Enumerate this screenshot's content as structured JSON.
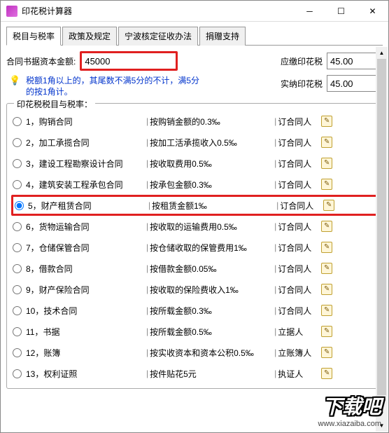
{
  "titlebar": {
    "title": "印花税计算器"
  },
  "tabs": {
    "t1": "税目与税率",
    "t2": "政策及规定",
    "t3": "宁波核定征收办法",
    "t4": "捐赠支持"
  },
  "fields": {
    "amountLabel": "合同书据资本金额:",
    "amountValue": "45000",
    "hint": "税额1角以上的，其尾数不满5分的不计，满5分的按1角计。",
    "payableLabel": "应缴印花税",
    "payableValue": "45.00",
    "actualLabel": "实纳印花税",
    "actualValue": "45.00"
  },
  "groupTitle": "印花税税目与税率：",
  "items": [
    {
      "n": "1，购销合同",
      "d": "按购销金额的0.3‰",
      "p": "订合同人"
    },
    {
      "n": "2，加工承揽合同",
      "d": "按加工活承揽收入0.5‰",
      "p": "订合同人"
    },
    {
      "n": "3，建设工程勘察设计合同",
      "d": "按收取费用0.5‰",
      "p": "订合同人"
    },
    {
      "n": "4，建筑安装工程承包合同",
      "d": "按承包金额0.3‰",
      "p": "订合同人"
    },
    {
      "n": "5，财产租赁合同",
      "d": "按租赁金额1‰",
      "p": "订合同人"
    },
    {
      "n": "6，货物运输合同",
      "d": "按收取的运输费用0.5‰",
      "p": "订合同人"
    },
    {
      "n": "7，仓储保管合同",
      "d": "按仓储收取的保管费用1‰",
      "p": "订合同人"
    },
    {
      "n": "8，借款合同",
      "d": "按借款金额0.05‰",
      "p": "订合同人"
    },
    {
      "n": "9，财产保险合同",
      "d": "按收取的保险费收入1‰",
      "p": "订合同人"
    },
    {
      "n": "10，技术合同",
      "d": "按所载金额0.3‰",
      "p": "订合同人"
    },
    {
      "n": "11，书据",
      "d": "按所载金额0.5‰",
      "p": "立据人"
    },
    {
      "n": "12，账簿",
      "d": "按实收资本和资本公积0.5‰",
      "p": "立账簿人"
    },
    {
      "n": "13，权利证照",
      "d": "按件贴花5元",
      "p": "执证人"
    }
  ],
  "selectedIndex": 4,
  "watermark": {
    "title": "下载吧",
    "url": "www.xiazaiba.com"
  }
}
